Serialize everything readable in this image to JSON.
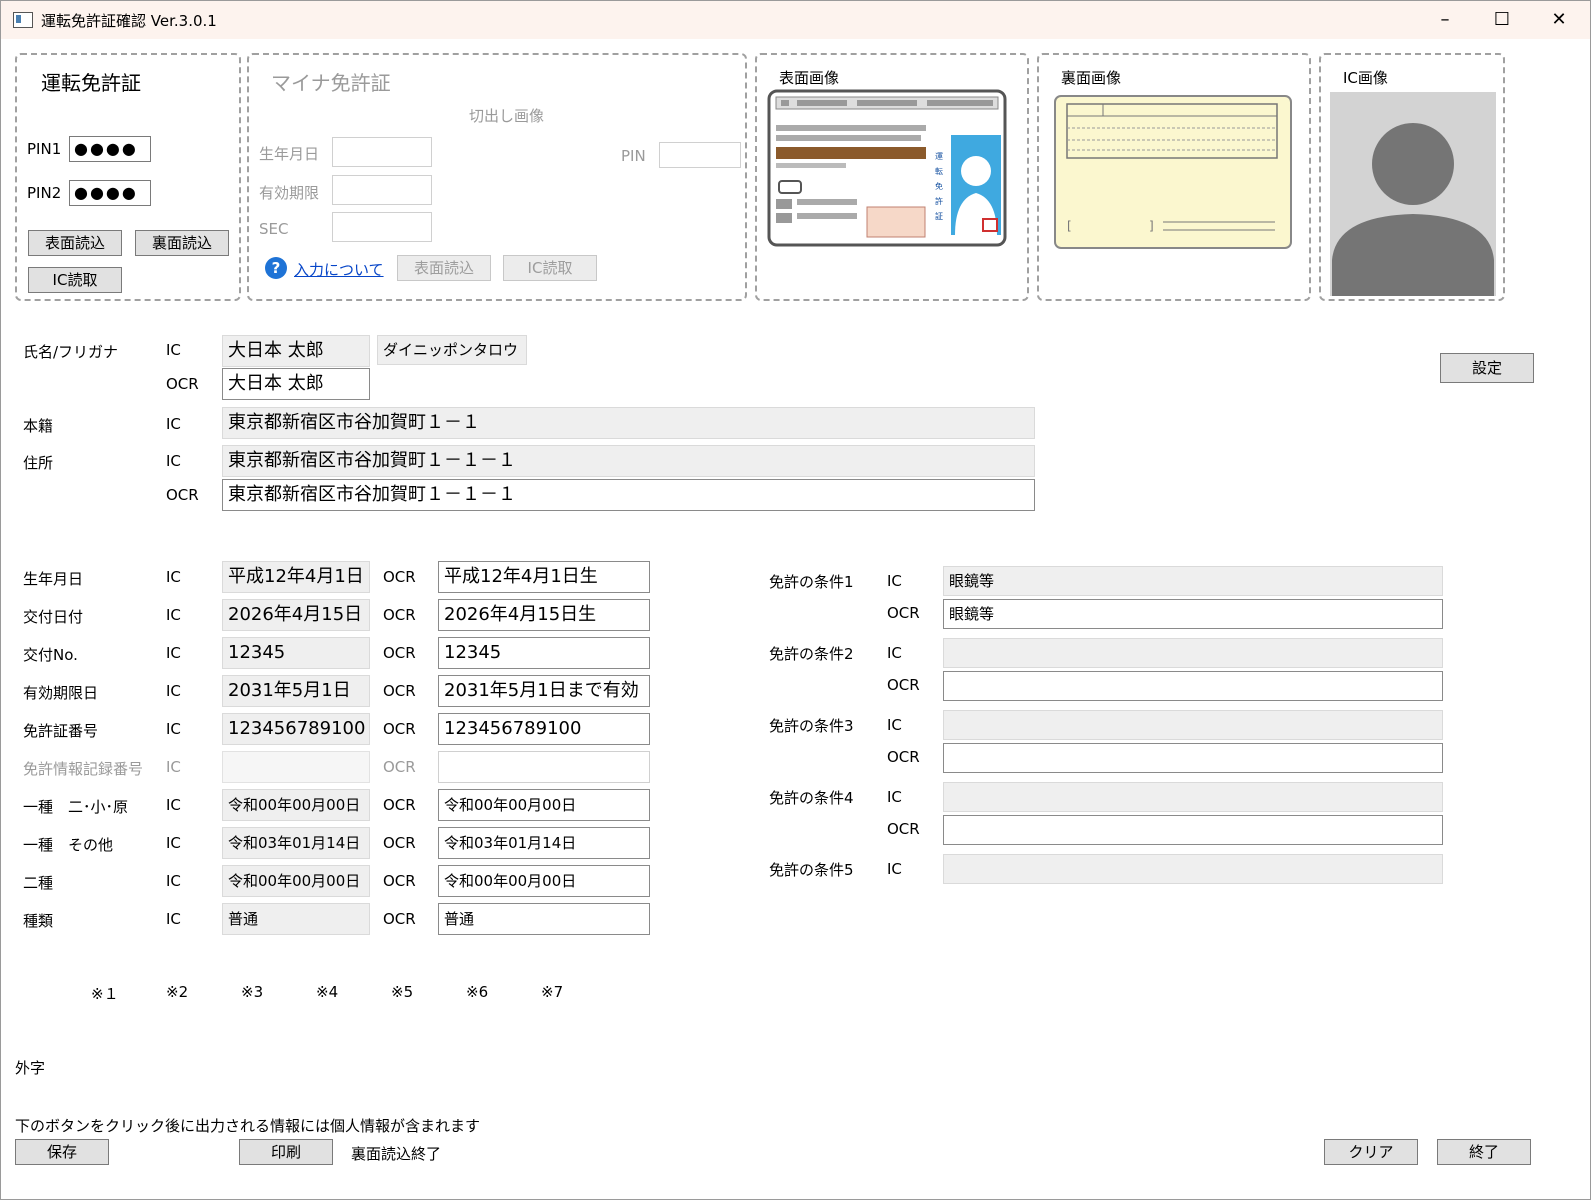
{
  "window": {
    "title": "運転免許証確認 Ver.3.0.1"
  },
  "license_group": {
    "title": "運転免許証",
    "pin1_label": "PIN1",
    "pin1_value": "●●●●",
    "pin2_label": "PIN2",
    "pin2_value": "●●●●",
    "front_read": "表面読込",
    "back_read": "裏面読込",
    "ic_read": "IC読取"
  },
  "myna_group": {
    "title": "マイナ免許証",
    "crop_label": "切出し画像",
    "birth_label": "生年月日",
    "expiry_label": "有効期限",
    "sec_label": "SEC",
    "pin_label": "PIN",
    "help_link": "入力について",
    "front_read": "表面読込",
    "ic_read": "IC読取"
  },
  "images": {
    "front": "表面画像",
    "back": "裏面画像",
    "ic": "IC画像"
  },
  "name": {
    "label": "氏名/フリガナ",
    "ic": "IC",
    "ocr": "OCR",
    "ic_value": "大日本 太郎",
    "kana_value": "ダイニッポンタロウ",
    "ocr_value": "大日本 太郎"
  },
  "honseki": {
    "label": "本籍",
    "ic": "IC",
    "ic_value": "東京都新宿区市谷加賀町１－１"
  },
  "address": {
    "label": "住所",
    "ic": "IC",
    "ocr": "OCR",
    "ic_value": "東京都新宿区市谷加賀町１－１－１",
    "ocr_value": "東京都新宿区市谷加賀町１－１－１"
  },
  "settings_button": "設定",
  "details": [
    {
      "label": "生年月日",
      "ic": "IC",
      "ic_value": "平成12年4月1日",
      "ocr": "OCR",
      "ocr_value": "平成12年4月1日生"
    },
    {
      "label": "交付日付",
      "ic": "IC",
      "ic_value": "2026年4月15日",
      "ocr": "OCR",
      "ocr_value": "2026年4月15日生"
    },
    {
      "label": "交付No.",
      "ic": "IC",
      "ic_value": "12345",
      "ocr": "OCR",
      "ocr_value": "12345"
    },
    {
      "label": "有効期限日",
      "ic": "IC",
      "ic_value": "2031年5月1日",
      "ocr": "OCR",
      "ocr_value": "2031年5月1日まで有効"
    },
    {
      "label": "免許証番号",
      "ic": "IC",
      "ic_value": "123456789100",
      "ocr": "OCR",
      "ocr_value": "123456789100"
    },
    {
      "label": "免許情報記録番号",
      "ic": "IC",
      "ic_value": "",
      "ocr": "OCR",
      "ocr_value": ""
    },
    {
      "label": "一種　二･小･原",
      "ic": "IC",
      "ic_value": "令和00年00月00日",
      "ocr": "OCR",
      "ocr_value": "令和00年00月00日"
    },
    {
      "label": "一種　その他",
      "ic": "IC",
      "ic_value": "令和03年01月14日",
      "ocr": "OCR",
      "ocr_value": "令和03年01月14日"
    },
    {
      "label": "二種",
      "ic": "IC",
      "ic_value": "令和00年00月00日",
      "ocr": "OCR",
      "ocr_value": "令和00年00月00日"
    },
    {
      "label": "種類",
      "ic": "IC",
      "ic_value": "普通",
      "ocr": "OCR",
      "ocr_value": "普通"
    }
  ],
  "conditions": [
    {
      "label": "免許の条件1",
      "ic": "IC",
      "ic_value": "眼鏡等",
      "ocr": "OCR",
      "ocr_value": "眼鏡等"
    },
    {
      "label": "免許の条件2",
      "ic": "IC",
      "ic_value": "",
      "ocr": "OCR",
      "ocr_value": ""
    },
    {
      "label": "免許の条件3",
      "ic": "IC",
      "ic_value": "",
      "ocr": "OCR",
      "ocr_value": ""
    },
    {
      "label": "免許の条件4",
      "ic": "IC",
      "ic_value": "",
      "ocr": "OCR",
      "ocr_value": ""
    },
    {
      "label": "免許の条件5",
      "ic": "IC",
      "ic_value": ""
    }
  ],
  "notes": [
    "※１",
    "※2",
    "※3",
    "※4",
    "※5",
    "※6",
    "※7"
  ],
  "gaiji_label": "外字",
  "footer": {
    "warning": "下のボタンをクリック後に出力される情報には個人情報が含まれます",
    "save": "保存",
    "print": "印刷",
    "status": "裏面読込終了",
    "clear": "クリア",
    "exit": "終了"
  }
}
